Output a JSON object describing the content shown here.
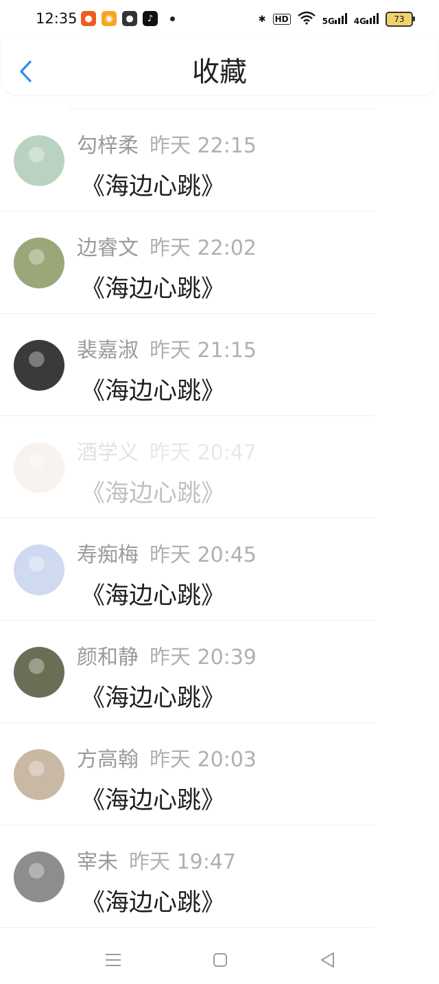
{
  "status_bar": {
    "time": "12:35",
    "net_5g": "5G",
    "net_4g": "4G",
    "hd": "HD",
    "battery": "73"
  },
  "header": {
    "title": "收藏"
  },
  "items": [
    {
      "name": "勾梓柔",
      "time": "昨天 22:15",
      "text": "《海边心跳》",
      "avatar_color": "#b9d3c0"
    },
    {
      "name": "边睿文",
      "time": "昨天 22:02",
      "text": "《海边心跳》",
      "avatar_color": "#9aa879"
    },
    {
      "name": "裴嘉淑",
      "time": "昨天 21:15",
      "text": "《海边心跳》",
      "avatar_color": "#3a3a3a"
    },
    {
      "name": "酒学义",
      "time": "昨天 20:47",
      "text": "《海边心跳》",
      "avatar_color": "#e7d7c6"
    },
    {
      "name": "寿痴梅",
      "time": "昨天 20:45",
      "text": "《海边心跳》",
      "avatar_color": "#cfd9f0"
    },
    {
      "name": "颜和静",
      "time": "昨天 20:39",
      "text": "《海边心跳》",
      "avatar_color": "#6b6e54"
    },
    {
      "name": "方高翰",
      "time": "昨天 20:03",
      "text": "《海边心跳》",
      "avatar_color": "#c9b8a4"
    },
    {
      "name": "宰未",
      "time": "昨天 19:47",
      "text": "《海边心跳》",
      "avatar_color": "#8d8d8d"
    }
  ],
  "colors": {
    "accent": "#2d8cf0",
    "name_gray": "#9a9a9a",
    "text_dark": "#1f1f1f"
  }
}
